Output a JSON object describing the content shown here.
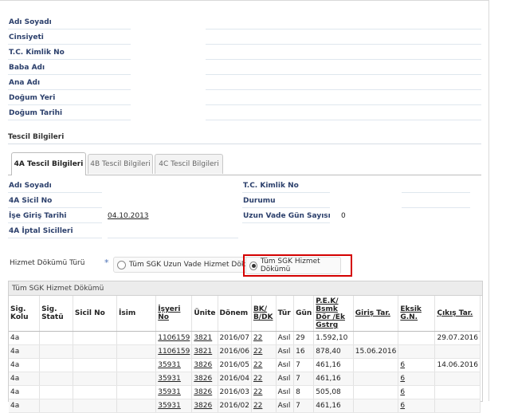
{
  "personal": {
    "labels": [
      "Adı Soyadı",
      "Cinsiyeti",
      "T.C. Kimlik No",
      "Baba Adı",
      "Ana Adı",
      "Doğum Yeri",
      "Doğum Tarihi"
    ]
  },
  "section_title": "Tescil Bilgileri",
  "tabs": [
    {
      "label": "4A Tescil Bilgileri",
      "active": true
    },
    {
      "label": "4B Tescil Bilgileri",
      "active": false
    },
    {
      "label": "4C Tescil Bilgileri",
      "active": false
    }
  ],
  "tescil": {
    "left": [
      {
        "label": "Adı Soyadı",
        "value": ""
      },
      {
        "label": "4A Sicil No",
        "value": ""
      },
      {
        "label": "İşe Giriş Tarihi",
        "value": "04.10.2013"
      },
      {
        "label": "4A İptal Sicilleri",
        "value": ""
      }
    ],
    "right": [
      {
        "label": "T.C. Kimlik No",
        "value": ""
      },
      {
        "label": "Durumu",
        "value": ""
      },
      {
        "label": "Uzun Vade Gün Sayısı",
        "value": "0"
      }
    ]
  },
  "hizmet": {
    "label": "Hizmet Dökümü Türü",
    "required_mark": "*",
    "option1": "Tüm SGK Uzun Vade Hizmet Dökümü",
    "option2": "Tüm SGK Hizmet Dökümü",
    "selected": "option2"
  },
  "panel_title": "Tüm SGK Hizmet Dökümü",
  "table": {
    "headers": [
      "Sig. Kolu",
      "Sig. Statü",
      "Sicil No",
      "İsim",
      "İşyeri No",
      "Ünite",
      "Dönem",
      "BK/ B/DK",
      "Tür",
      "Gün",
      "P.E.K/ Bsmk Dör /Ek Gstrg",
      "Giriş Tar.",
      "Eksik G.N.",
      "Çıkış Tar."
    ],
    "rows": [
      [
        "4a",
        "",
        "",
        "",
        "1106159",
        "3821",
        "2016/07",
        "22",
        "Asıl",
        "29",
        "1.592,10",
        "",
        "",
        "29.07.2016"
      ],
      [
        "4a",
        "",
        "",
        "",
        "1106159",
        "3821",
        "2016/06",
        "22",
        "Asıl",
        "16",
        "878,40",
        "15.06.2016",
        "",
        ""
      ],
      [
        "4a",
        "",
        "",
        "",
        "35931",
        "3826",
        "2016/05",
        "22",
        "Asıl",
        "7",
        "461,16",
        "",
        "6",
        "14.06.2016"
      ],
      [
        "4a",
        "",
        "",
        "",
        "35931",
        "3826",
        "2016/04",
        "22",
        "Asıl",
        "7",
        "461,16",
        "",
        "6",
        ""
      ],
      [
        "4a",
        "",
        "",
        "",
        "35931",
        "3826",
        "2016/03",
        "22",
        "Asıl",
        "8",
        "505,08",
        "",
        "6",
        ""
      ],
      [
        "4a",
        "",
        "",
        "",
        "35931",
        "3826",
        "2016/02",
        "22",
        "Asıl",
        "7",
        "461,16",
        "",
        "6",
        ""
      ]
    ]
  }
}
